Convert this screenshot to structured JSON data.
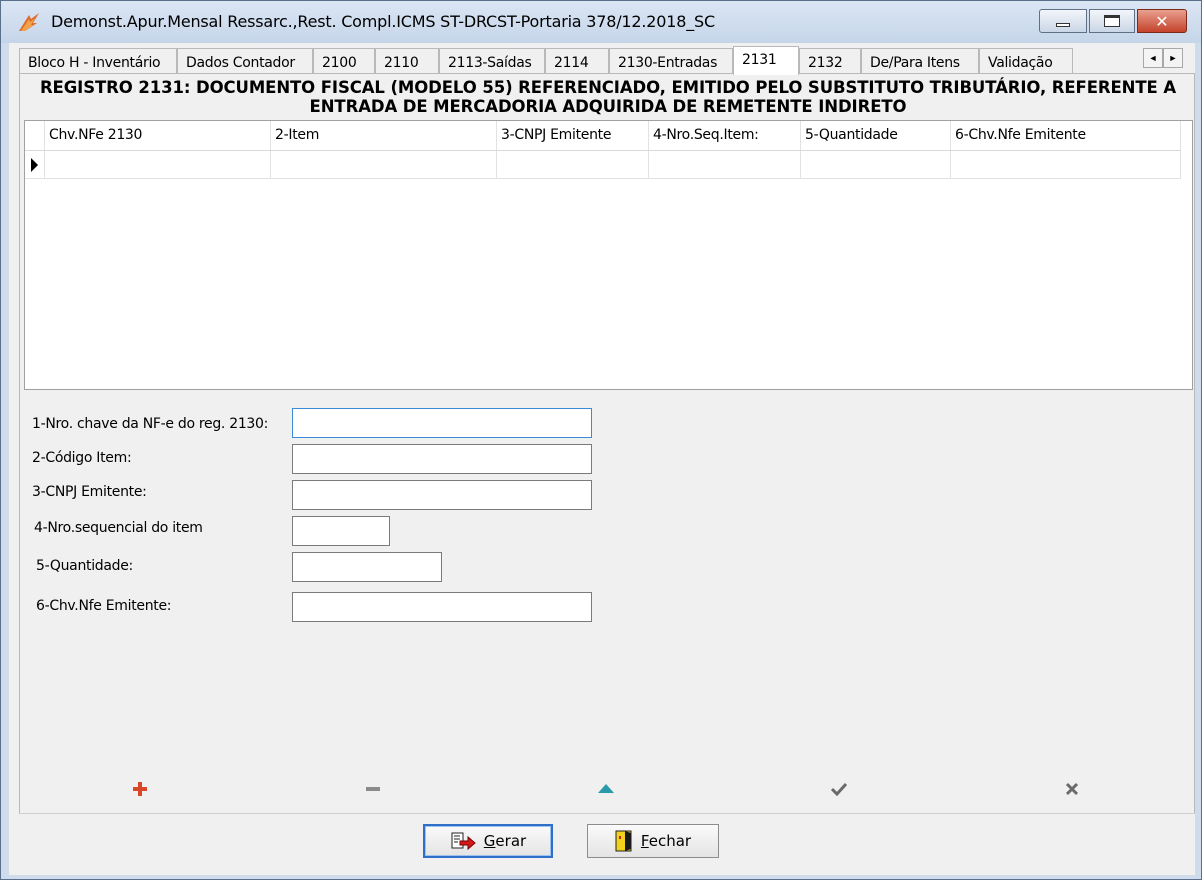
{
  "window": {
    "title": "Demonst.Apur.Mensal Ressarc.,Rest. Compl.ICMS ST-DRCST-Portaria 378/12.2018_SC",
    "minimize_icon": "minimize-icon",
    "maximize_icon": "maximize-icon",
    "close_icon": "close-icon",
    "close_glyph": "✕"
  },
  "tabs": [
    {
      "label": "Bloco H - Inventário"
    },
    {
      "label": "Dados Contador"
    },
    {
      "label": "2100"
    },
    {
      "label": "2110"
    },
    {
      "label": "2113-Saídas"
    },
    {
      "label": "2114"
    },
    {
      "label": "2130-Entradas"
    },
    {
      "label": "2131",
      "active": true
    },
    {
      "label": "2132"
    },
    {
      "label": "De/Para Itens"
    },
    {
      "label": "Validação"
    }
  ],
  "tab_scroll": {
    "left": "◄",
    "right": "►"
  },
  "panel": {
    "title_line1": "REGISTRO 2131: DOCUMENTO FISCAL (MODELO 55) REFERENCIADO, EMITIDO PELO SUBSTITUTO TRIBUTÁRIO, REFERENTE A",
    "title_line2": "ENTRADA DE MERCADORIA ADQUIRIDA DE REMETENTE INDIRETO"
  },
  "grid": {
    "columns": [
      "Chv.NFe 2130",
      "2-Item",
      "3-CNPJ Emitente",
      "4-Nro.Seq.Item:",
      "5-Quantidade",
      "6-Chv.Nfe Emitente"
    ],
    "rows": [
      [
        "",
        "",
        "",
        "",
        "",
        ""
      ]
    ]
  },
  "form": {
    "field1_label": "1-Nro. chave da NF-e do reg. 2130:",
    "field1_value": "",
    "field2_label": "2-Código Item:",
    "field2_value": "",
    "field3_label": "3-CNPJ Emitente:",
    "field3_value": "",
    "field4_label": "4-Nro.sequencial do item",
    "field4_value": "",
    "field5_label": "5-Quantidade:",
    "field5_value": "",
    "field6_label": "6-Chv.Nfe Emitente:",
    "field6_value": ""
  },
  "navigator": {
    "insert_icon": "plus-icon",
    "delete_icon": "minus-icon",
    "edit_icon": "triangle-up-icon",
    "post_icon": "check-icon",
    "cancel_icon": "x-icon"
  },
  "buttons": {
    "gerar_label": "Gerar",
    "fechar_label": "Fechar"
  },
  "colors": {
    "plus": "#d9472b",
    "minus": "#8a8a8a",
    "triangle": "#2a9aa8",
    "check": "#6a6a6a",
    "x": "#6a6a6a"
  }
}
